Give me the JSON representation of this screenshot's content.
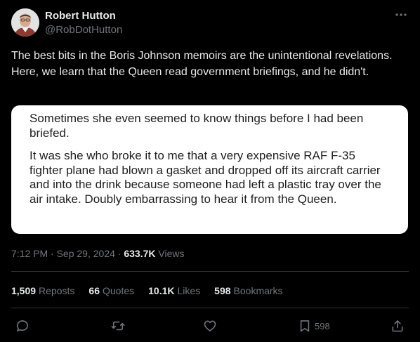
{
  "author": {
    "display_name": "Robert Hutton",
    "handle": "@RobDotHutton"
  },
  "tweet": {
    "text": "The best bits in the Boris Johnson memoirs are the unintentional revelations. Here, we learn that the Queen read government briefings, and he didn't."
  },
  "quote_image": {
    "paragraph_1": "Sometimes she even seemed to know things before I had been briefed.",
    "paragraph_2": "It was she who broke it to me that a very expensive RAF F-35 fighter plane had blown a gasket and dropped off its aircraft carrier and into the drink because someone had left a plastic tray over the air intake. Doubly embarrassing to hear it from the Queen."
  },
  "meta": {
    "time": "7:12 PM",
    "separator": " · ",
    "date": "Sep 29, 2024",
    "views_count": "633.7K",
    "views_label": "Views"
  },
  "stats": [
    {
      "count": "1,509",
      "label": "Reposts"
    },
    {
      "count": "66",
      "label": "Quotes"
    },
    {
      "count": "10.1K",
      "label": "Likes"
    },
    {
      "count": "598",
      "label": "Bookmarks"
    }
  ],
  "actions": {
    "reply_icon": "reply-icon",
    "repost_icon": "repost-icon",
    "like_icon": "like-icon",
    "bookmark_icon": "bookmark-icon",
    "bookmark_count": "598",
    "share_icon": "share-icon",
    "more_icon": "more-icon"
  },
  "colors": {
    "background": "#000000",
    "text_primary": "#e7e9ea",
    "text_secondary": "#71767b",
    "divider": "#2f3336",
    "card_background": "#ffffff"
  }
}
